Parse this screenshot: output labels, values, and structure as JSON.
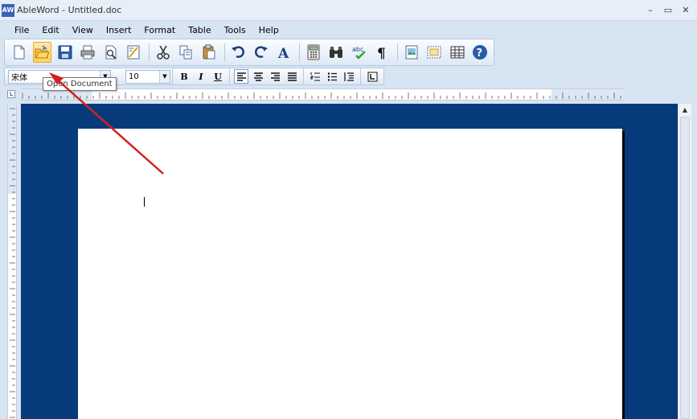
{
  "window": {
    "app_icon_text": "AW",
    "title": "AbleWord - Untitled.doc",
    "minimize": "–",
    "restore": "▭",
    "close": "✕"
  },
  "menu": {
    "items": [
      {
        "label": "File"
      },
      {
        "label": "Edit"
      },
      {
        "label": "View"
      },
      {
        "label": "Insert"
      },
      {
        "label": "Format"
      },
      {
        "label": "Table"
      },
      {
        "label": "Tools"
      },
      {
        "label": "Help"
      }
    ]
  },
  "toolbar": {
    "buttons": [
      {
        "icon": "new-document-icon"
      },
      {
        "icon": "open-folder-icon",
        "state": "hover"
      },
      {
        "icon": "save-icon"
      },
      {
        "icon": "print-icon"
      },
      {
        "icon": "print-preview-icon"
      },
      {
        "icon": "page-setup-icon"
      },
      {
        "icon": "cut-icon"
      },
      {
        "icon": "copy-icon"
      },
      {
        "icon": "paste-icon"
      },
      {
        "icon": "undo-icon"
      },
      {
        "icon": "redo-icon"
      },
      {
        "icon": "font-icon"
      },
      {
        "icon": "calculator-icon"
      },
      {
        "icon": "find-icon"
      },
      {
        "icon": "spell-check-icon"
      },
      {
        "icon": "pilcrow-icon"
      },
      {
        "icon": "insert-image-icon"
      },
      {
        "icon": "frame-icon"
      },
      {
        "icon": "table-icon"
      },
      {
        "icon": "help-icon"
      }
    ],
    "spellcheck_text": "abc",
    "font_letter": "A",
    "pilcrow": "¶",
    "help_glyph": "?"
  },
  "format_bar": {
    "font_name": "宋体",
    "font_size": "10",
    "bold": "B",
    "italic": "I",
    "underline": "U",
    "align_left_pressed": true
  },
  "tooltip": {
    "text": "Open Document"
  },
  "colors": {
    "doc_background": "#073a7a",
    "annotation_arrow": "#d42020",
    "chrome": "#d7e4f2"
  }
}
